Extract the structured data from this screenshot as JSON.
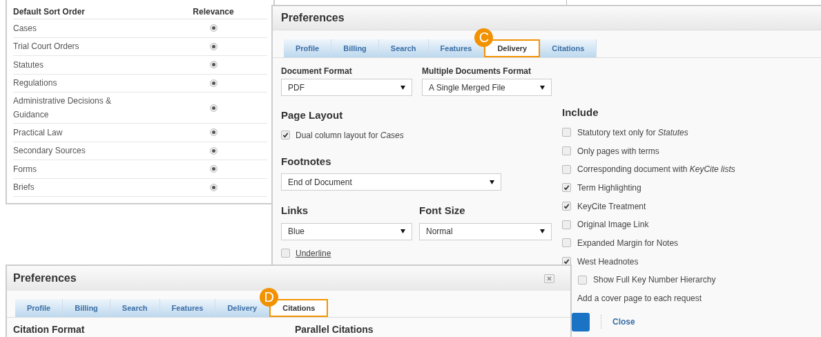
{
  "sort_panel": {
    "columns": [
      "Default Sort Order",
      "Relevance"
    ],
    "rows": [
      {
        "label": "Cases",
        "selected": true
      },
      {
        "label": "Trial Court Orders",
        "selected": true
      },
      {
        "label": "Statutes",
        "selected": true
      },
      {
        "label": "Regulations",
        "selected": true
      },
      {
        "label": "Administrative Decisions & Guidance",
        "selected": true
      },
      {
        "label": "Practical Law",
        "selected": true
      },
      {
        "label": "Secondary Sources",
        "selected": true
      },
      {
        "label": "Forms",
        "selected": true
      },
      {
        "label": "Briefs",
        "selected": true
      }
    ]
  },
  "delivery_dialog": {
    "title": "Preferences",
    "callout": "C",
    "tabs": [
      {
        "label": "Profile",
        "selected": false
      },
      {
        "label": "Billing",
        "selected": false
      },
      {
        "label": "Search",
        "selected": false
      },
      {
        "label": "Features",
        "selected": false
      },
      {
        "label": "Delivery",
        "selected": true
      },
      {
        "label": "Citations",
        "selected": false
      }
    ],
    "document_format": {
      "label": "Document Format",
      "value": "PDF"
    },
    "multiple_documents_format": {
      "label": "Multiple Documents Format",
      "value": "A Single Merged File"
    },
    "page_layout": {
      "heading": "Page Layout",
      "options": [
        {
          "label": "Dual column layout for *Cases*",
          "checked": true
        }
      ]
    },
    "footnotes": {
      "heading": "Footnotes",
      "value": "End of Document"
    },
    "links": {
      "heading": "Links",
      "value": "Blue",
      "underline": {
        "label": "Underline",
        "checked": false
      }
    },
    "font_size": {
      "heading": "Font Size",
      "value": "Normal"
    },
    "include": {
      "heading": "Include",
      "options": [
        {
          "label": "Statutory text only for *Statutes*",
          "checked": false
        },
        {
          "label": "Only pages with terms",
          "checked": false
        },
        {
          "label": "Corresponding document with *KeyCite lists*",
          "checked": false
        },
        {
          "label": "Term Highlighting",
          "checked": true
        },
        {
          "label": "KeyCite Treatment",
          "checked": true
        },
        {
          "label": "Original Image Link",
          "checked": false
        },
        {
          "label": "Expanded Margin for Notes",
          "checked": false
        },
        {
          "label": "West Headnotes",
          "checked": true,
          "children": [
            {
              "label": "Show Full Key Number Hierarchy",
              "checked": false
            }
          ]
        }
      ]
    },
    "cover_page": "Add a cover page to each request",
    "close": "Close"
  },
  "citations_dialog": {
    "title": "Preferences",
    "callout": "D",
    "tabs": [
      {
        "label": "Profile",
        "selected": false
      },
      {
        "label": "Billing",
        "selected": false
      },
      {
        "label": "Search",
        "selected": false
      },
      {
        "label": "Features",
        "selected": false
      },
      {
        "label": "Delivery",
        "selected": false
      },
      {
        "label": "Citations",
        "selected": true
      }
    ],
    "headings": [
      "Citation Format",
      "Parallel Citations"
    ]
  }
}
